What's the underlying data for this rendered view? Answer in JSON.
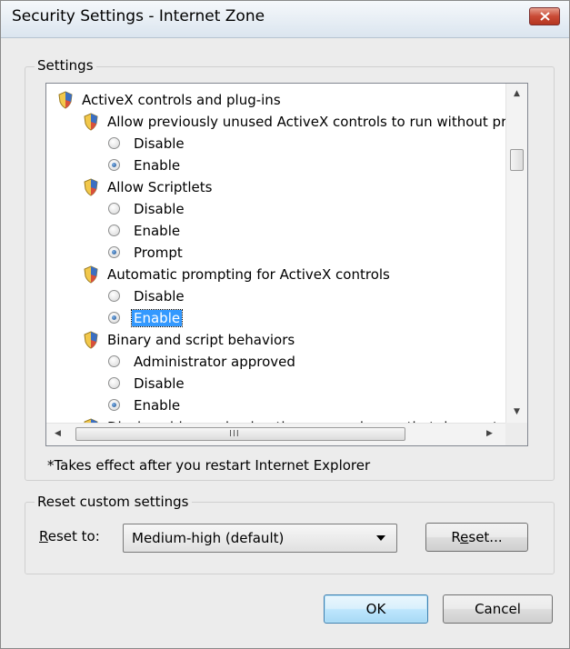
{
  "window": {
    "title": "Security Settings - Internet Zone"
  },
  "settings_group": {
    "legend": "Settings",
    "tree": [
      {
        "kind": "category",
        "label": "ActiveX controls and plug-ins"
      },
      {
        "kind": "setting",
        "label": "Allow previously unused ActiveX controls to run without prom"
      },
      {
        "kind": "option",
        "label": "Disable",
        "checked": false
      },
      {
        "kind": "option",
        "label": "Enable",
        "checked": true
      },
      {
        "kind": "setting",
        "label": "Allow Scriptlets"
      },
      {
        "kind": "option",
        "label": "Disable",
        "checked": false
      },
      {
        "kind": "option",
        "label": "Enable",
        "checked": false
      },
      {
        "kind": "option",
        "label": "Prompt",
        "checked": true
      },
      {
        "kind": "setting",
        "label": "Automatic prompting for ActiveX controls"
      },
      {
        "kind": "option",
        "label": "Disable",
        "checked": false
      },
      {
        "kind": "option",
        "label": "Enable",
        "checked": true,
        "selected": true
      },
      {
        "kind": "setting",
        "label": "Binary and script behaviors"
      },
      {
        "kind": "option",
        "label": "Administrator approved",
        "checked": false
      },
      {
        "kind": "option",
        "label": "Disable",
        "checked": false
      },
      {
        "kind": "option",
        "label": "Enable",
        "checked": true
      },
      {
        "kind": "setting",
        "label": "Display video and animation on a webpage that does not use"
      }
    ],
    "hscroll_grip": "III",
    "note": "*Takes effect after you restart Internet Explorer"
  },
  "reset_group": {
    "legend": "Reset custom settings",
    "reset_to_label": "Reset to:",
    "reset_to_value": "Medium-high (default)",
    "reset_button": "Reset..."
  },
  "buttons": {
    "ok": "OK",
    "cancel": "Cancel"
  },
  "colors": {
    "selection": "#3399ff",
    "dialog_bg": "#ececec",
    "close_button": "#c94a35"
  },
  "icons": {
    "tree_item": "security-shield-icon",
    "close": "close-icon"
  }
}
